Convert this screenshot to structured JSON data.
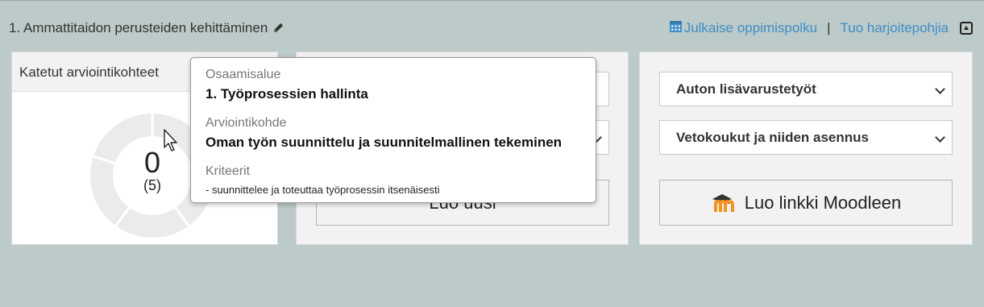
{
  "header": {
    "title": "1. Ammattitaidon perusteiden kehittäminen",
    "publish_link": "Julkaise oppimispolku",
    "separator": "|",
    "import_link": "Tuo harjoitepohjia"
  },
  "panel_left": {
    "heading": "Katetut arviointikohteet",
    "covered": "0",
    "total": "(5)",
    "covered_fraction": 0
  },
  "panel_middle": {
    "create_button": "Luo uusi"
  },
  "panel_right": {
    "select1": "Auton lisävarustetyöt",
    "select2": "Vetokoukut ja niiden asennus",
    "moodle_button": "Luo linkki Moodleen"
  },
  "tooltip": {
    "label1": "Osaamisalue",
    "value1": "1. Työprosessien hallinta",
    "label2": "Arviointikohde",
    "value2": "Oman työn suunnittelu ja suunnitelmallinen tekeminen",
    "label3": "Kriteerit",
    "value3": "- suunnittelee ja toteuttaa työprosessin itsenäisesti"
  },
  "colors": {
    "background": "#bccac9",
    "link": "#3f8ec7",
    "panel": "#f2f2f2",
    "donut": "#ebebeb",
    "moodle_orange": "#f7931e"
  }
}
